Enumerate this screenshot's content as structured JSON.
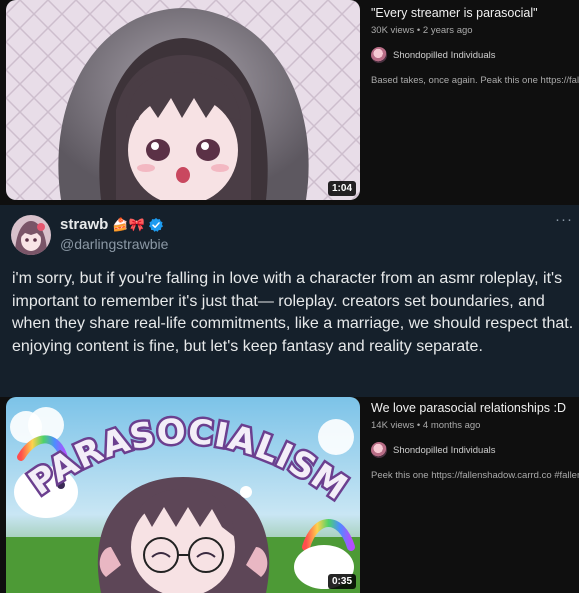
{
  "video_top": {
    "title": "\"Every streamer is parasocial\"",
    "stats": "30K views • 2 years ago",
    "channel": "Shondopilled Individuals",
    "description": "Based takes, once again. Peak this one https://fallensha",
    "duration": "1:04"
  },
  "tweet": {
    "display_name": "strawb",
    "emoji": "🍰🎀",
    "handle": "@darlingstrawbie",
    "more": "···",
    "text": "i'm sorry, but if you're falling in love with a character from an asmr roleplay, it's important to remember it's just that— roleplay. creators set boundaries, and when they share real-life commitments, like a marriage, we should respect that. enjoying content is fine, but let's keep fantasy and reality separate."
  },
  "video_bottom": {
    "title": "We love parasocial relationships :D",
    "stats": "14K views • 4 months ago",
    "channel": "Shondopilled Individuals",
    "description": "Peek this one https://fallenshadow.carrd.co #fallensha",
    "duration": "0:35",
    "thumbnail_text": "PARASOCIALISM"
  },
  "colors": {
    "youtube_bg": "#0f0f0f",
    "tweet_bg": "#15202b",
    "verified_blue": "#1d9bf0",
    "thumbnail_text_fill": "#f3eef8",
    "thumbnail_text_stroke": "#6b3f8f"
  }
}
